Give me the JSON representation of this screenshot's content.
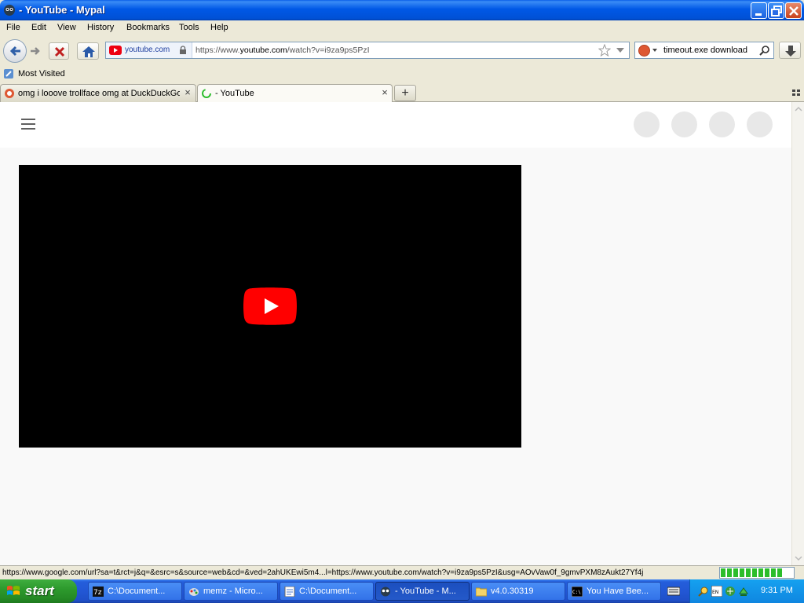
{
  "window": {
    "title": "- YouTube - Mypal",
    "minimize_label": "Minimize",
    "maximize_label": "Restore",
    "close_label": "Close"
  },
  "menu": {
    "items": [
      {
        "label": "File"
      },
      {
        "label": "Edit"
      },
      {
        "label": "View"
      },
      {
        "label": "History"
      },
      {
        "label": "Bookmarks"
      },
      {
        "label": "Tools"
      },
      {
        "label": "Help"
      }
    ]
  },
  "navbar": {
    "identity_domain": "youtube.com",
    "url_prefix": "https://www.",
    "url_host": "youtube.com",
    "url_path": "/watch?v=i9za9ps5PzI",
    "search_query": "timeout.exe download"
  },
  "bookmarks": {
    "items": [
      {
        "label": "Most Visited"
      }
    ]
  },
  "tabs": [
    {
      "label": "omg i looove trollface omg at DuckDuckGo",
      "active": false
    },
    {
      "label": "- YouTube",
      "active": true
    }
  ],
  "status": {
    "text": "https://www.google.com/url?sa=t&rct=j&q=&esrc=s&source=web&cd=&ved=2ahUKEwi5m4...l=https://www.youtube.com/watch?v=i9za9ps5PzI&usg=AOvVaw0f_9gmvPXM8zAukt27Yf4j",
    "progress": 0.85
  },
  "taskbar": {
    "start_label": "start",
    "tasks": [
      {
        "label": "C:\\Document...",
        "icon": "7zip-icon",
        "active": false
      },
      {
        "label": "memz - Micro...",
        "icon": "paint-icon",
        "active": false
      },
      {
        "label": "C:\\Document...",
        "icon": "notepad-icon",
        "active": false
      },
      {
        "label": "- YouTube - M...",
        "icon": "mypal-icon",
        "active": true
      },
      {
        "label": "v4.0.30319",
        "icon": "folder-icon",
        "active": false
      },
      {
        "label": "You Have Bee...",
        "icon": "cmd-icon",
        "active": false
      }
    ],
    "clock": "9:31 PM"
  },
  "colors": {
    "youtube_red": "#ff0000",
    "xp_blue": "#245edb",
    "start_green": "#2d9a2d"
  }
}
